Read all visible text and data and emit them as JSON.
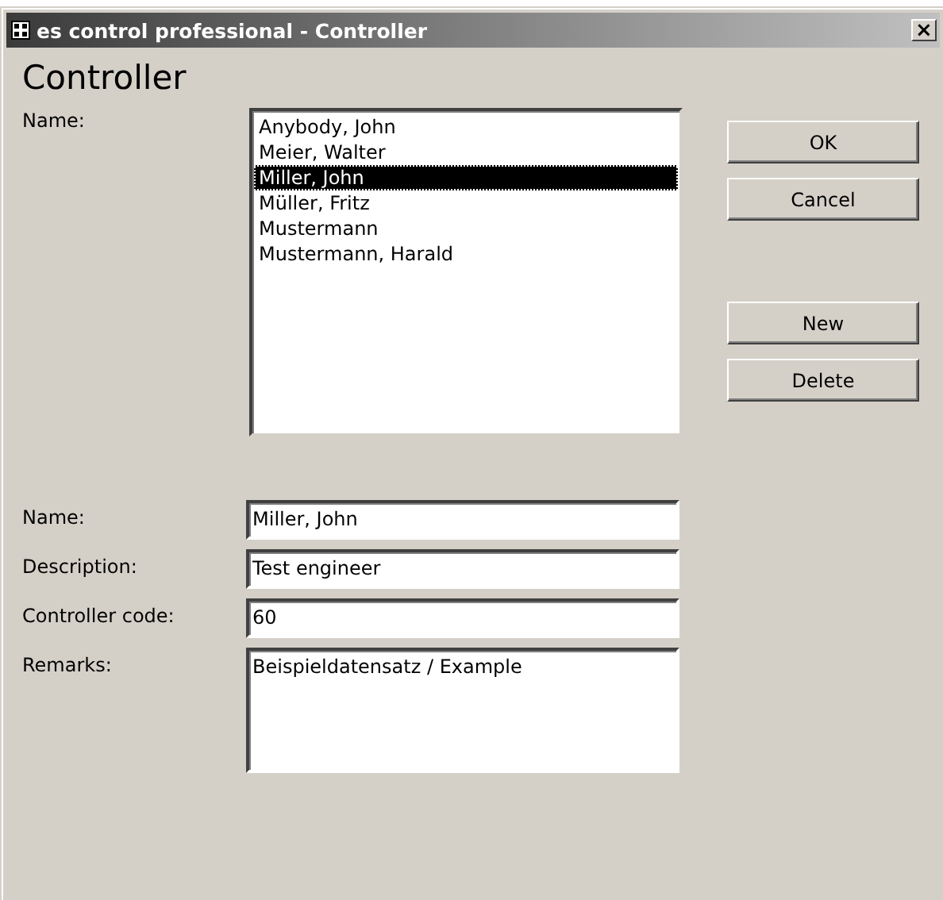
{
  "window": {
    "title": "es control professional - Controller",
    "close": "×"
  },
  "heading": "Controller",
  "list": {
    "label": "Name:",
    "items": [
      {
        "text": "Anybody, John",
        "selected": false
      },
      {
        "text": "Meier, Walter",
        "selected": false
      },
      {
        "text": "Miller, John",
        "selected": true
      },
      {
        "text": "Müller, Fritz",
        "selected": false
      },
      {
        "text": "Mustermann",
        "selected": false
      },
      {
        "text": "Mustermann, Harald",
        "selected": false
      }
    ]
  },
  "button_groups": [
    [
      "OK",
      "Cancel"
    ],
    [
      "New",
      "Delete"
    ]
  ],
  "fields": [
    {
      "label": "Name:",
      "value": "Miller, John",
      "kind": "line"
    },
    {
      "label": "Description:",
      "value": "Test engineer",
      "kind": "line"
    },
    {
      "label": "Controller code:",
      "value": "60",
      "kind": "line"
    },
    {
      "label": "Remarks:",
      "value": "Beispieldatensatz / Example",
      "kind": "multiline"
    }
  ]
}
